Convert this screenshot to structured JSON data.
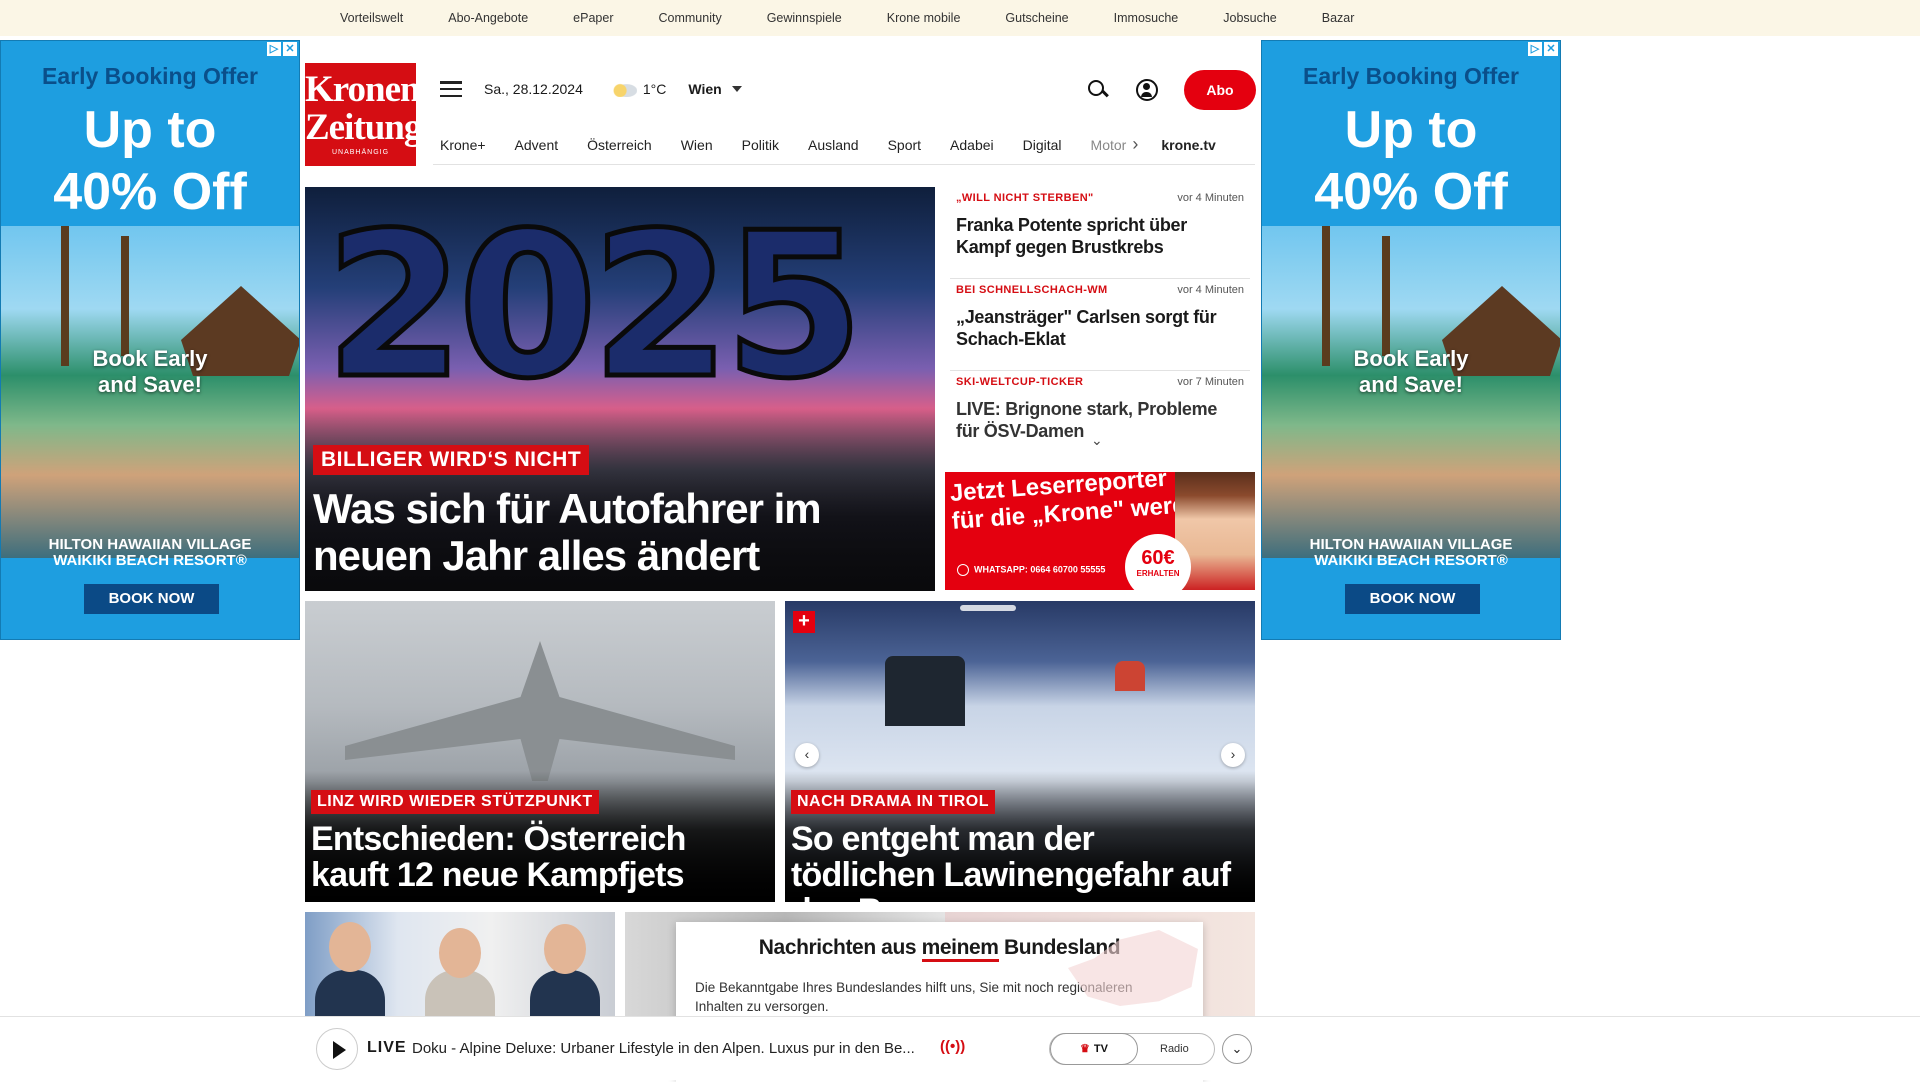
{
  "topbar": {
    "links": [
      "Vorteilswelt",
      "Abo-Angebote",
      "ePaper",
      "Community",
      "Gewinnspiele",
      "Krone mobile",
      "Gutscheine",
      "Immosuche",
      "Jobsuche",
      "Bazar"
    ]
  },
  "ad": {
    "headline": "Early Booking Offer",
    "offer_line1": "Up to",
    "offer_line2": "40% Off",
    "sub_line1": "Book Early",
    "sub_line2": "and Save!",
    "brand_line1": "HILTON HAWAIIAN VILLAGE",
    "brand_line2": "WAIKIKI BEACH RESORT®",
    "cta": "BOOK NOW",
    "adchoice_info": "▷",
    "adchoice_close": "✕",
    "brand_color": "#1e9ee0"
  },
  "logo": {
    "line1": "Kronen",
    "line2": "Zeitung",
    "tagline": "UNABHÄNGIG",
    "color": "#d50d13"
  },
  "header": {
    "date": "Sa., 28.12.2024",
    "temperature": "1°C",
    "city": "Wien",
    "abo_label": "Abo"
  },
  "nav": {
    "items": [
      "Krone+",
      "Advent",
      "Österreich",
      "Wien",
      "Politik",
      "Ausland",
      "Sport",
      "Adabei",
      "Digital"
    ],
    "faded_item": "Motor",
    "more_arrow": "›",
    "kronetv": "krone.tv"
  },
  "hero": {
    "image_text": "2025",
    "kicker": "BILLIGER WIRD‘S NICHT",
    "headline": "Was sich für Autofahrer im neuen Jahr alles ändert"
  },
  "ticker": [
    {
      "tag": "„WILL NICHT STERBEN\"",
      "time": "vor 4 Minuten",
      "headline": "Franka Potente spricht über Kampf gegen Brustkrebs"
    },
    {
      "tag": "BEI SCHNELLSCHACH-WM",
      "time": "vor 4 Minuten",
      "headline": "„Jeansträger\" Carlsen sorgt für Schach-Eklat"
    },
    {
      "tag": "SKI-WELTCUP-TICKER",
      "time": "vor 7 Minuten",
      "headline": "LIVE: Brignone stark, Probleme für ÖSV-Damen"
    }
  ],
  "ticker_expand": "⌄",
  "promo": {
    "line1": "Jetzt Leserreporter",
    "line2": "für die „Krone\" werden",
    "whatsapp": "WHATSAPP: 0664 60700 55555",
    "amount": "60€",
    "amount_sub": "ERHALTEN"
  },
  "cards": [
    {
      "kicker": "LINZ WIRD WIEDER STÜTZPUNKT",
      "headline": "Entschieden: Österreich kauft 12 neue Kampfjets"
    },
    {
      "kicker": "NACH DRAMA IN TIROL",
      "headline": "So entgeht man der tödlichen Lawinengefahr auf den Bergen",
      "plus": "+",
      "prev": "‹",
      "next": "›"
    }
  ],
  "bundesland": {
    "title_pre": "Nachrichten aus ",
    "title_em": "meinem",
    "title_post": " Bundesland",
    "text": "Die Bekanntgabe Ihres Bundeslandes hilft uns, Sie mit noch regionaleren Inhalten zu versorgen."
  },
  "player": {
    "live_label": "LIVE",
    "show_title": "Doku - Alpine Deluxe: Urbaner Lifestyle in den Alpen. Luxus pur in den Be...",
    "broadcast_icon": "((•))",
    "tv_icon": "♛",
    "tv_label": "TV",
    "radio_label": "Radio",
    "expand_icon": "⌄"
  }
}
